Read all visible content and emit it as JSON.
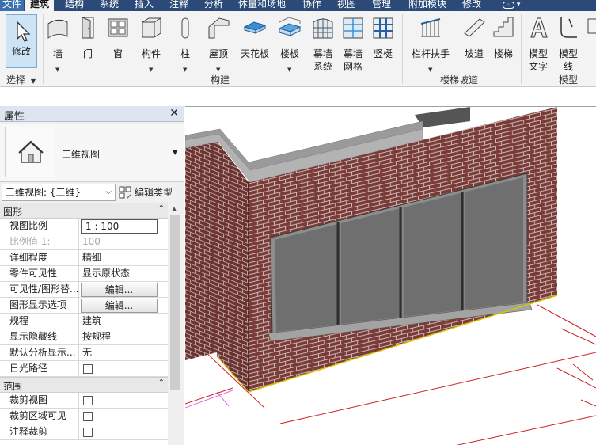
{
  "ribbon": {
    "tabs": [
      "文件",
      "建筑",
      "结构",
      "系统",
      "插入",
      "注释",
      "分析",
      "体量和场地",
      "协作",
      "视图",
      "管理",
      "附加模块",
      "修改"
    ],
    "active_tab": "建筑",
    "select_panel": {
      "modify": "修改",
      "title": "选择"
    },
    "build_panel": {
      "title": "构建",
      "buttons": {
        "wall": "墙",
        "door": "门",
        "window": "窗",
        "component": "构件",
        "column": "柱",
        "roof": "屋顶",
        "ceiling": "天花板",
        "floor": "楼板",
        "curtain_system_1": "幕墙",
        "curtain_system_2": "系统",
        "curtain_grid_1": "幕墙",
        "curtain_grid_2": "网格",
        "mullion": "竖梃"
      }
    },
    "stair_panel": {
      "title": "楼梯坡道",
      "buttons": {
        "railing": "栏杆扶手",
        "ramp": "坡道",
        "stair": "楼梯"
      }
    },
    "model_panel": {
      "title": "模型",
      "buttons": {
        "model_text_1": "模型",
        "model_text_2": "文字",
        "model_line_1": "模型",
        "model_line_2": "线"
      }
    }
  },
  "properties": {
    "title": "属性",
    "type_name": "三维视图",
    "instance_selector": "三维视图: {三维}",
    "edit_type": "编辑类型",
    "groups": {
      "graphics": "图形",
      "extents": "范围"
    },
    "rows": {
      "view_scale": {
        "label": "视图比例",
        "value": "1 : 100"
      },
      "scale_value": {
        "label": "比例值 1:",
        "value": "100"
      },
      "detail_level": {
        "label": "详细程度",
        "value": "精细"
      },
      "parts_visibility": {
        "label": "零件可见性",
        "value": "显示原状态"
      },
      "vg_overrides": {
        "label": "可见性/图形替...",
        "value": "编辑..."
      },
      "graphic_display": {
        "label": "图形显示选项",
        "value": "编辑..."
      },
      "discipline": {
        "label": "规程",
        "value": "建筑"
      },
      "hidden_lines": {
        "label": "显示隐藏线",
        "value": "按规程"
      },
      "analysis_display": {
        "label": "默认分析显示...",
        "value": "无"
      },
      "sun_path": {
        "label": "日光路径"
      },
      "crop_view": {
        "label": "裁剪视图"
      },
      "crop_visible": {
        "label": "裁剪区域可见"
      },
      "annotation_crop": {
        "label": "注释裁剪"
      }
    }
  },
  "colors": {
    "tab_bar": "#2b4a77",
    "brick": "#7a3a37",
    "mortar": "#c9b8b2",
    "glass": "#6f6f6f",
    "level_lines": "#cc2222"
  }
}
